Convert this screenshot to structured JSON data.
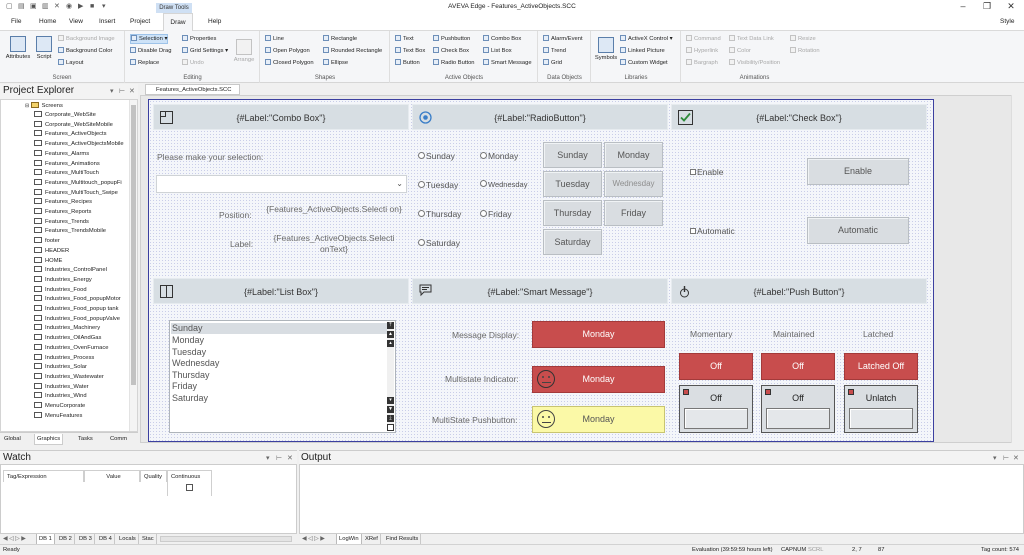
{
  "app": {
    "title": "AVEVA Edge - Features_ActiveObjects.SCC",
    "context_tab": "Draw Tools",
    "style_label": "Style"
  },
  "menu": {
    "tabs": [
      "File",
      "Home",
      "View",
      "Insert",
      "Project",
      "Draw",
      "Help"
    ],
    "active": "Draw"
  },
  "ribbon": {
    "groups": {
      "screen": "Screen",
      "editing": "Editing",
      "shapes": "Shapes",
      "active_objects": "Active Objects",
      "data_objects": "Data Objects",
      "libraries": "Libraries",
      "animations": "Animations"
    },
    "screen": {
      "attributes": "Attributes",
      "script": "Script",
      "background_image": "Background Image",
      "background_color": "Background Color",
      "layout": "Layout"
    },
    "editing": {
      "selection": "Selection",
      "disable_drag": "Disable Drag",
      "replace": "Replace",
      "properties": "Properties",
      "grid_settings": "Grid Settings",
      "undo": "Undo",
      "arrange": "Arrange"
    },
    "shapes": {
      "line": "Line",
      "open_polygon": "Open Polygon",
      "closed_polygon": "Closed Polygon",
      "rectangle": "Rectangle",
      "rounded_rectangle": "Rounded Rectangle",
      "ellipse": "Ellipse"
    },
    "active_objects": {
      "text": "Text",
      "text_box": "Text Box",
      "button": "Button",
      "pushbutton": "Pushbutton",
      "check_box": "Check Box",
      "radio_button": "Radio Button",
      "combo_box": "Combo Box",
      "list_box": "List Box",
      "smart_message": "Smart Message"
    },
    "data_objects": {
      "alarm_event": "Alarm/Event",
      "trend": "Trend",
      "grid": "Grid"
    },
    "libraries": {
      "symbols": "Symbols",
      "activex_control": "ActiveX Control",
      "linked_picture": "Linked Picture",
      "custom_widget": "Custom Widget"
    },
    "animations": {
      "command": "Command",
      "hyperlink": "Hyperlink",
      "bargraph": "Bargraph",
      "text_data_link": "Text Data Link",
      "color": "Color",
      "visibility_position": "Visibility/Position",
      "resize": "Resize",
      "rotation": "Rotation"
    }
  },
  "explorer": {
    "title": "Project Explorer",
    "root": "Screens",
    "items": [
      "Corporate_WebSite",
      "Corporate_WebSiteMobile",
      "Features_ActiveObjects",
      "Features_ActiveObjectsMobile",
      "Features_Alarms",
      "Features_Animations",
      "Features_MultiTouch",
      "Features_Multitouch_popupFi",
      "Features_MultiTouch_Swipe",
      "Features_Recipes",
      "Features_Reports",
      "Features_Trends",
      "Features_TrendsMobile",
      "footer",
      "HEADER",
      "HOME",
      "Industries_ControlPanel",
      "Industries_Energy",
      "Industries_Food",
      "Industries_Food_popupMotor",
      "Industries_Food_popup tank",
      "Industries_Food_popupValve",
      "Industries_Machinery",
      "Industries_OilAndGas",
      "Industries_OvenFurnace",
      "Industries_Process",
      "Industries_Solar",
      "Industries_Wastewater",
      "Industries_Water",
      "Industries_Wind",
      "MenuCorporate",
      "MenuFeatures"
    ],
    "tabs": [
      "Global",
      "Graphics",
      "Tasks",
      "Comm"
    ],
    "active_tab": "Graphics"
  },
  "document": {
    "tab": "Features_ActiveObjects.SCC"
  },
  "combo_panel": {
    "title": "{#Label:\"Combo Box\"}",
    "prompt": "Please make your selection:",
    "position_label": "Position:",
    "position_value": "{Features_ActiveObjects.Selecti on}",
    "label_label": "Label:",
    "label_value": "{Features_ActiveObjects.Selecti onText}"
  },
  "radio_panel": {
    "title": "{#Label:\"RadioButton\"}",
    "radios_left": [
      "Sunday",
      "Tuesday",
      "Thursday",
      "Saturday"
    ],
    "radios_right": [
      "Monday",
      "Wednesday",
      "Friday"
    ],
    "buttons": [
      "Sunday",
      "Monday",
      "Tuesday",
      "Wednesday",
      "Thursday",
      "Friday",
      "Saturday"
    ]
  },
  "check_panel": {
    "title": "{#Label:\"Check Box\"}",
    "enable_check": "Enable",
    "enable_button": "Enable",
    "automatic_check": "Automatic",
    "automatic_button": "Automatic"
  },
  "list_panel": {
    "title": "{#Label:\"List Box\"}",
    "items": [
      "Sunday",
      "Monday",
      "Tuesday",
      "Wednesday",
      "Thursday",
      "Friday",
      "Saturday"
    ],
    "selected": "Sunday"
  },
  "smart_panel": {
    "title": "{#Label:\"Smart Message\"}",
    "display_label": "Message Display:",
    "display_value": "Monday",
    "indicator_label": "Multistate Indicator:",
    "indicator_value": "Monday",
    "pushbutton_label": "MultiState Pushbutton:",
    "pushbutton_value": "Monday"
  },
  "push_panel": {
    "title": "{#Label:\"Push Button\"}",
    "col_momentary": "Momentary",
    "col_maintained": "Maintained",
    "col_latched": "Latched",
    "momentary_state": "Off",
    "maintained_state": "Off",
    "latched_state": "Latched Off",
    "momentary_btn": "Off",
    "maintained_btn": "Off",
    "latched_btn": "Unlatch"
  },
  "watch": {
    "title": "Watch",
    "columns": [
      "Tag/Expression",
      "Value",
      "Quality",
      "Continuous"
    ],
    "tabs": [
      "DB 1",
      "DB 2",
      "DB 3",
      "DB 4",
      "Locals",
      "Stac"
    ]
  },
  "output": {
    "title": "Output",
    "tabs": [
      "LogWin",
      "XRef",
      "Find Results"
    ]
  },
  "status": {
    "left": "Ready",
    "evaluation": "Evaluation (39:59:59 hours left)",
    "cap": "CAP",
    "num": "NUM",
    "scrl": "SCRL",
    "coords": "2, 7",
    "size": "87",
    "tag_count": "Tag count: 574"
  },
  "colors": {
    "accent": "#c84d4d",
    "highlight": "#fbf9a7",
    "panel_header": "#d7dee3",
    "screen_border": "#3b3fa0"
  }
}
